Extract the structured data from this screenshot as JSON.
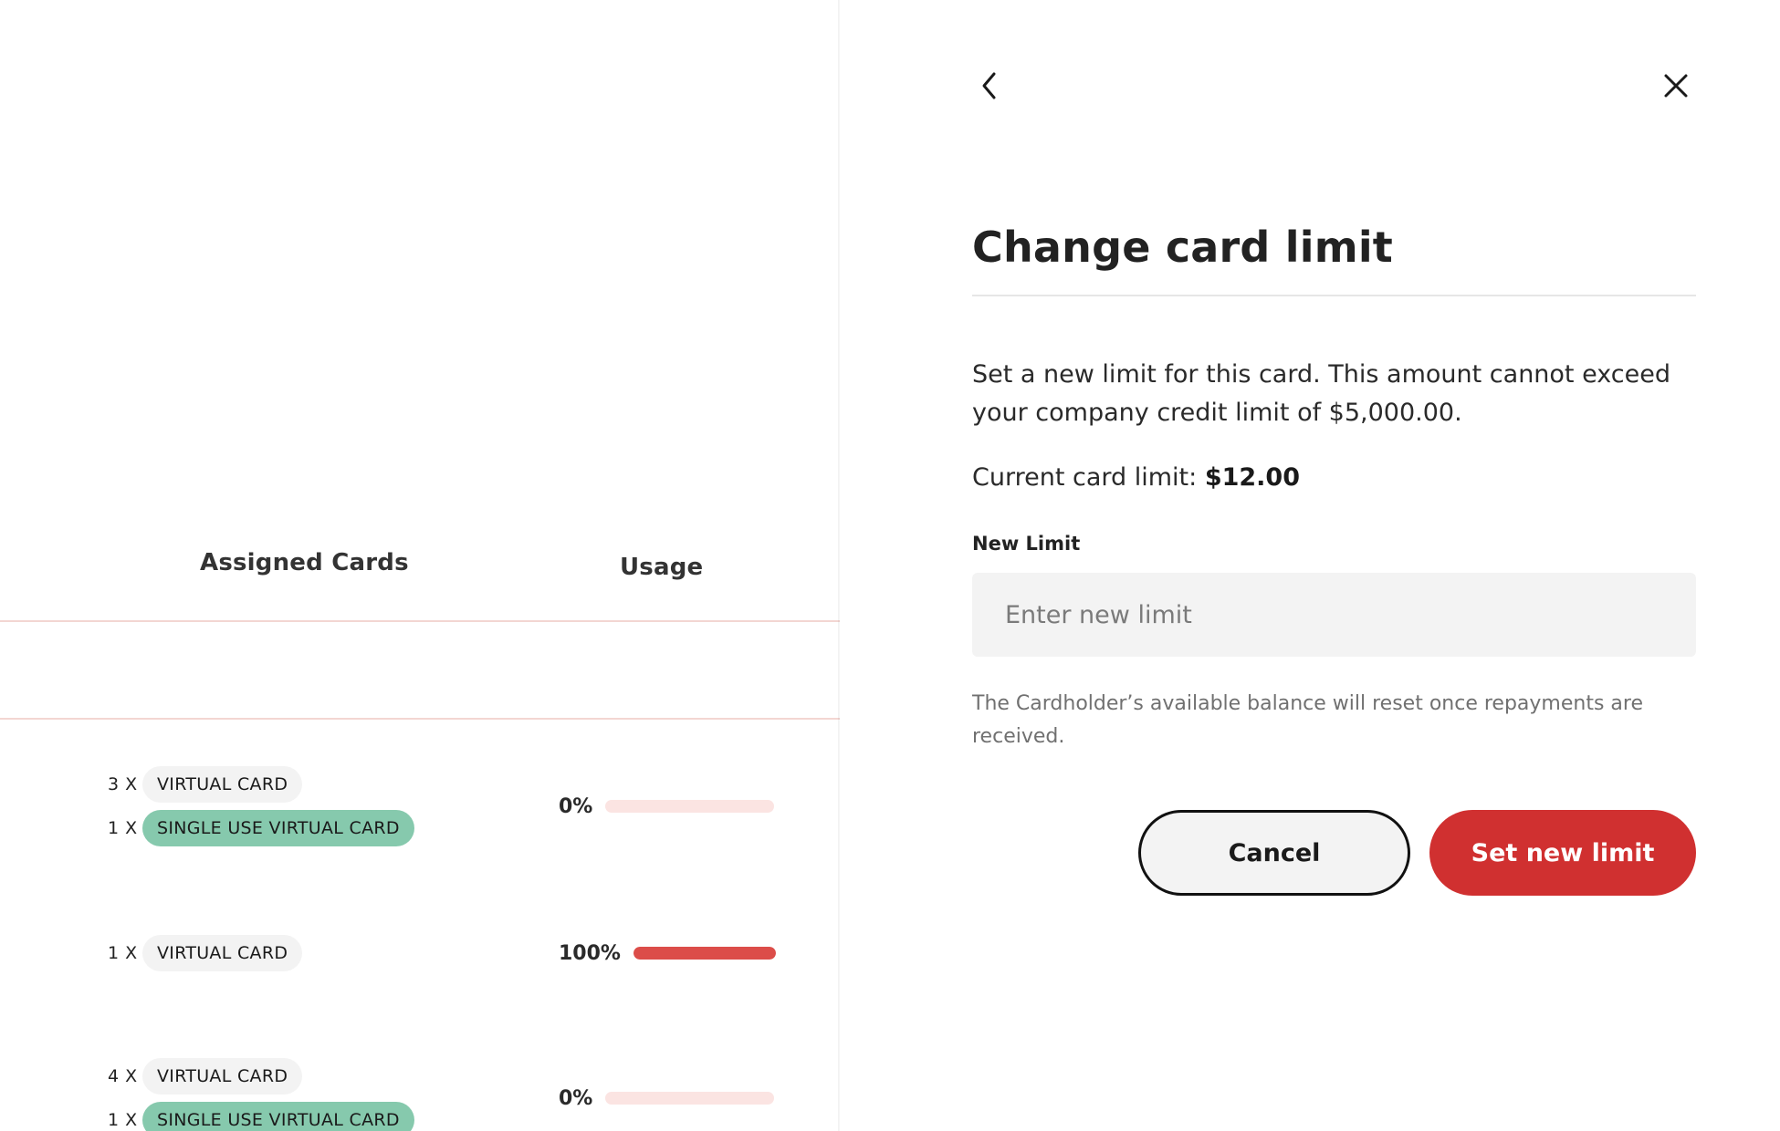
{
  "table": {
    "headers": {
      "cards": "Assigned Cards",
      "usage": "Usage"
    },
    "rows": [
      {
        "cards": [
          {
            "qty": "3 X",
            "type": "VIRTUAL CARD",
            "style": "plain"
          },
          {
            "qty": "1 X",
            "type": "SINGLE USE VIRTUAL CARD",
            "style": "green"
          }
        ],
        "usage": {
          "label": "0%",
          "fraction": 0.0
        }
      },
      {
        "cards": [
          {
            "qty": "1 X",
            "type": "VIRTUAL CARD",
            "style": "plain"
          }
        ],
        "usage": {
          "label": "100%",
          "fraction": 1.0
        }
      },
      {
        "cards": [
          {
            "qty": "4 X",
            "type": "VIRTUAL CARD",
            "style": "plain"
          },
          {
            "qty": "1 X",
            "type": "SINGLE USE VIRTUAL CARD",
            "style": "green"
          }
        ],
        "usage": {
          "label": "0%",
          "fraction": 0.0
        }
      }
    ]
  },
  "drawer": {
    "back_icon": "chevron-left-icon",
    "close_icon": "close-icon",
    "title": "Change card limit",
    "description": "Set a new limit for this card. This amount cannot exceed your company credit limit of $5,000.00.",
    "current_limit_label": "Current card limit: ",
    "current_limit_value": "$12.00",
    "new_limit_label": "New Limit",
    "new_limit_placeholder": "Enter new limit",
    "new_limit_value": "",
    "hint": "The Cardholder’s available balance will reset once repayments are received.",
    "cancel_label": "Cancel",
    "submit_label": "Set new limit"
  },
  "colors": {
    "accent_red": "#d03030",
    "usage_fill": "#dc4d49",
    "usage_track": "#fbe4e2",
    "chip_green": "#86c9ad",
    "chip_plain": "#f3f3f3"
  }
}
